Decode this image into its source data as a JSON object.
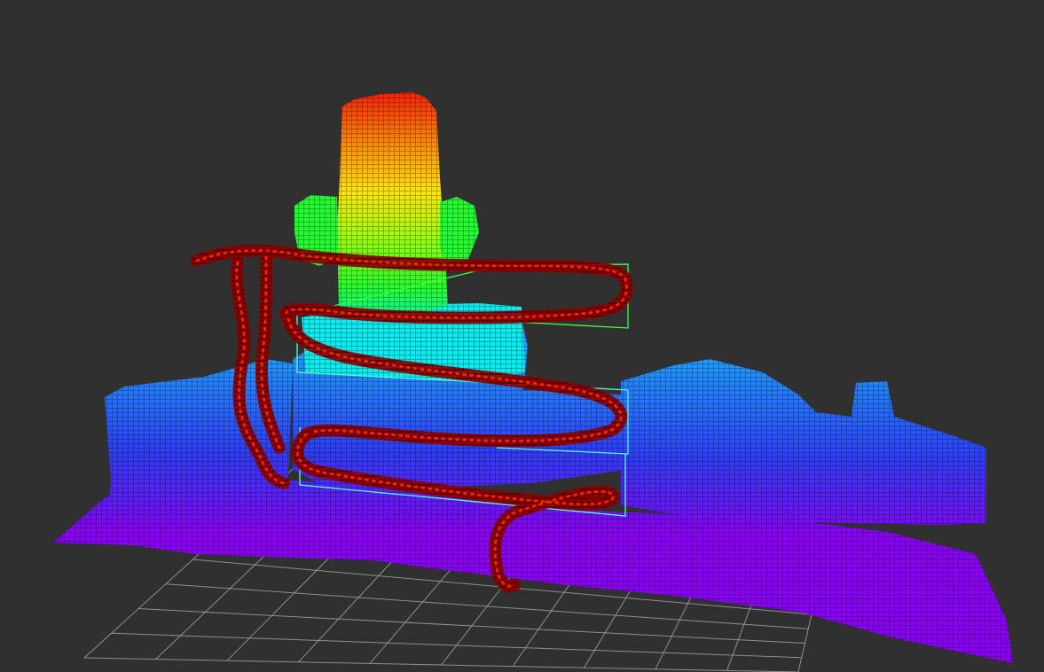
{
  "viewport": {
    "background_color": "#303030",
    "grid_color": "#a0a0a0"
  },
  "point_cloud": {
    "colormap": [
      "#8a00ff",
      "#2f3cff",
      "#1e9cff",
      "#00f0f0",
      "#20ff30",
      "#9cff00",
      "#ffe600",
      "#ff8a00",
      "#ff2000"
    ]
  },
  "trajectory": {
    "path_color": "#8b0000",
    "waypoint_color": "#ff2200"
  },
  "bounding_boxes": {
    "colors": [
      "#40ff40",
      "#50ffd0"
    ]
  }
}
